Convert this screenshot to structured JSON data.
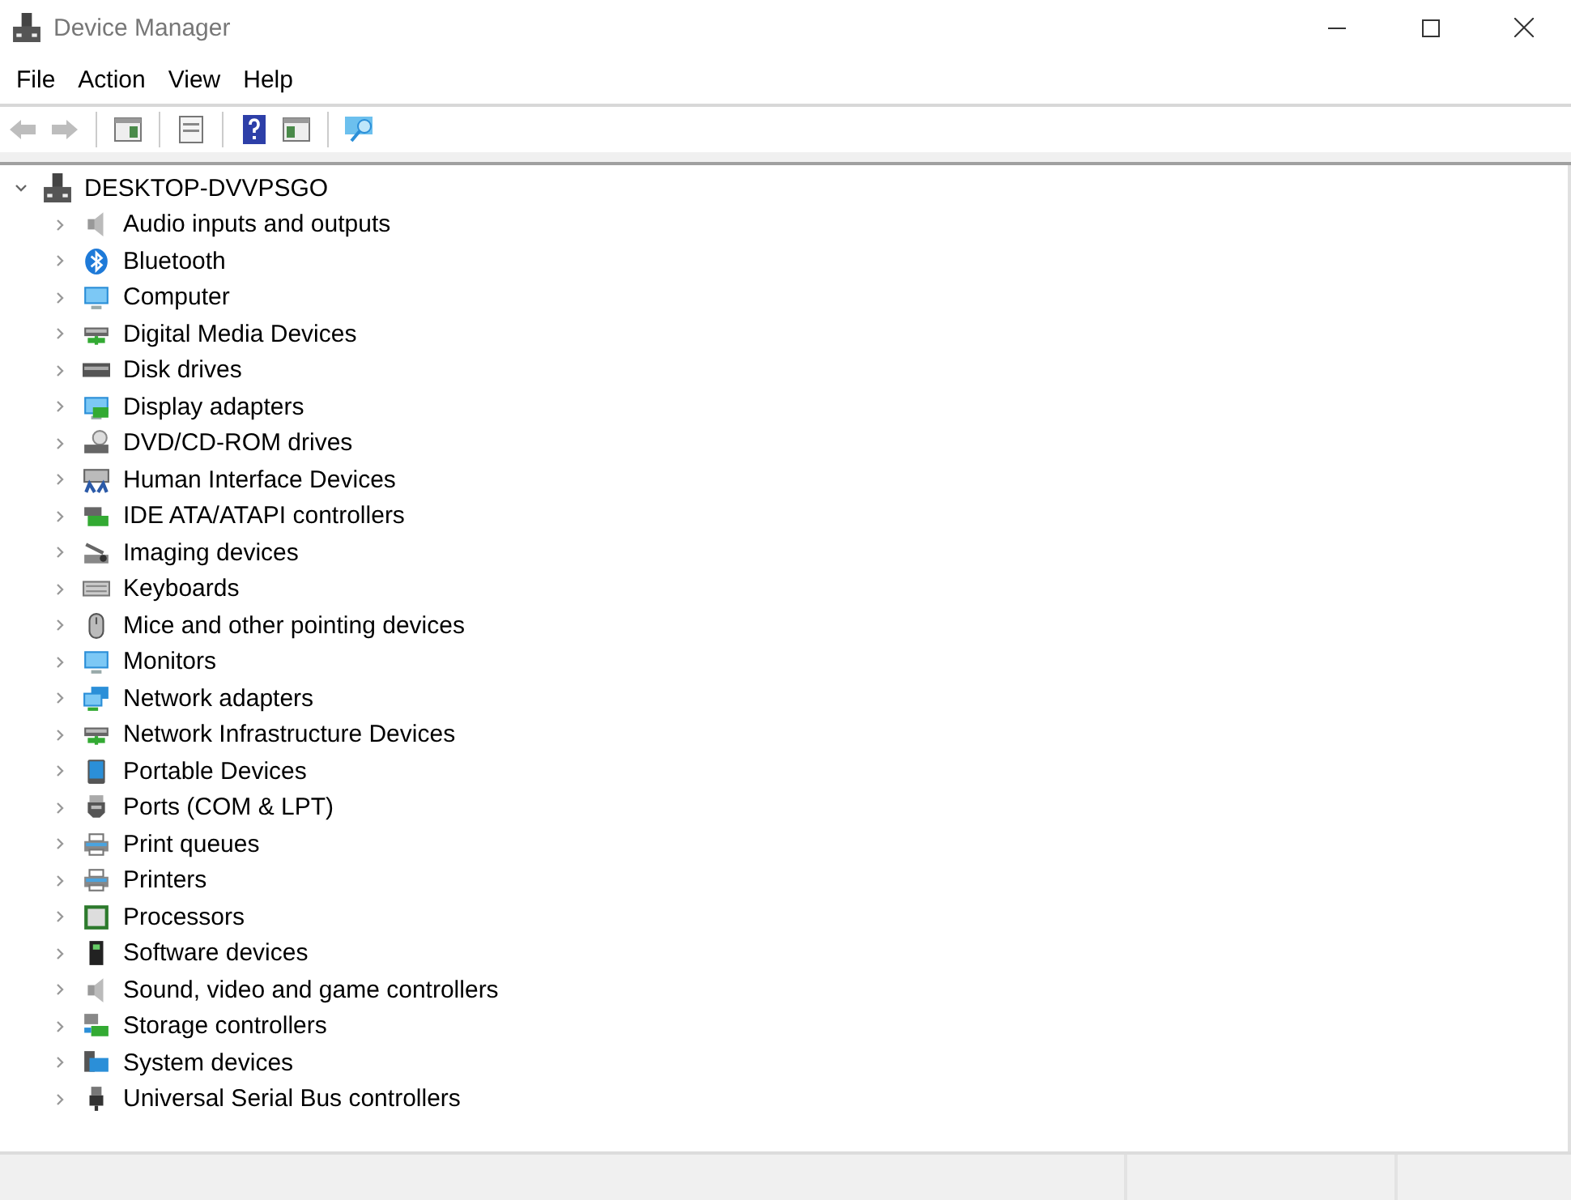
{
  "window": {
    "title": "Device Manager"
  },
  "menu": [
    "File",
    "Action",
    "View",
    "Help"
  ],
  "toolbar": [
    {
      "kind": "back",
      "disabled": true
    },
    {
      "kind": "forward",
      "disabled": true
    },
    {
      "kind": "separator"
    },
    {
      "kind": "console-tree",
      "disabled": false
    },
    {
      "kind": "separator"
    },
    {
      "kind": "properties",
      "disabled": false
    },
    {
      "kind": "separator"
    },
    {
      "kind": "help",
      "disabled": false
    },
    {
      "kind": "action-pane",
      "disabled": false
    },
    {
      "kind": "separator"
    },
    {
      "kind": "scan",
      "disabled": false
    }
  ],
  "tree": {
    "label": "DESKTOP-DVVPSGO",
    "expanded": true,
    "children": [
      {
        "label": "Audio inputs and outputs",
        "expanded": false
      },
      {
        "label": "Bluetooth",
        "expanded": false
      },
      {
        "label": "Computer",
        "expanded": false
      },
      {
        "label": "Digital Media Devices",
        "expanded": false
      },
      {
        "label": "Disk drives",
        "expanded": false
      },
      {
        "label": "Display adapters",
        "expanded": false
      },
      {
        "label": "DVD/CD-ROM drives",
        "expanded": false
      },
      {
        "label": "Human Interface Devices",
        "expanded": false
      },
      {
        "label": "IDE ATA/ATAPI controllers",
        "expanded": false
      },
      {
        "label": "Imaging devices",
        "expanded": false
      },
      {
        "label": "Keyboards",
        "expanded": false
      },
      {
        "label": "Mice and other pointing devices",
        "expanded": false
      },
      {
        "label": "Monitors",
        "expanded": false
      },
      {
        "label": "Network adapters",
        "expanded": false
      },
      {
        "label": "Network Infrastructure Devices",
        "expanded": false
      },
      {
        "label": "Portable Devices",
        "expanded": false
      },
      {
        "label": "Ports (COM & LPT)",
        "expanded": false
      },
      {
        "label": "Print queues",
        "expanded": false
      },
      {
        "label": "Printers",
        "expanded": false
      },
      {
        "label": "Processors",
        "expanded": false
      },
      {
        "label": "Software devices",
        "expanded": false
      },
      {
        "label": "Sound, video and game controllers",
        "expanded": false
      },
      {
        "label": "Storage controllers",
        "expanded": false
      },
      {
        "label": "System devices",
        "expanded": false
      },
      {
        "label": "Universal Serial Bus controllers",
        "expanded": false
      }
    ]
  }
}
